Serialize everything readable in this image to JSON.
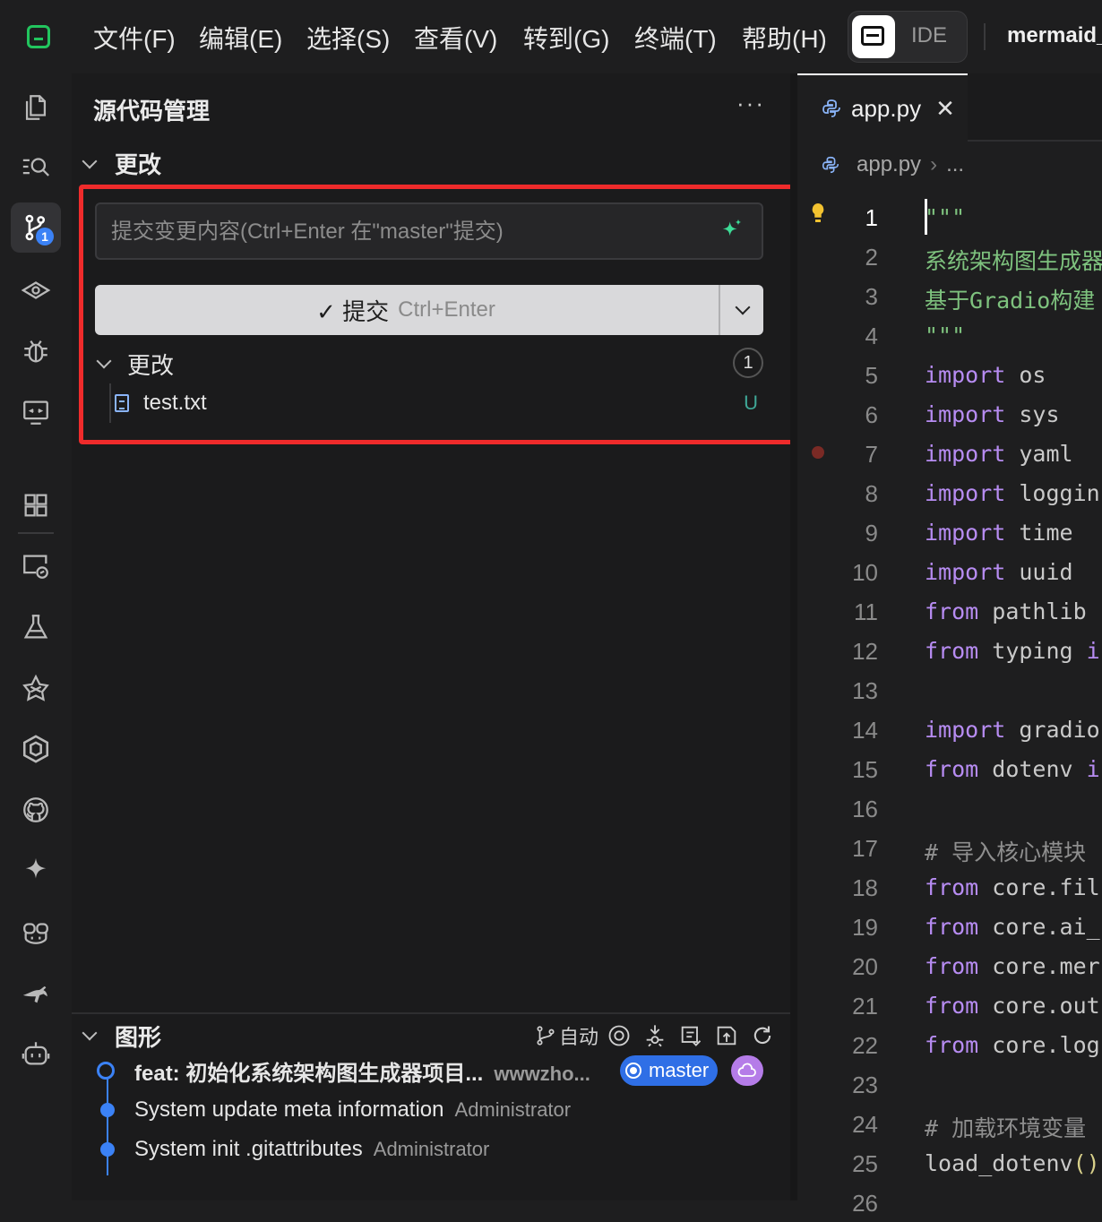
{
  "menu": {
    "items": [
      "文件(F)",
      "编辑(E)",
      "选择(S)",
      "查看(V)",
      "转到(G)",
      "终端(T)",
      "帮助(H)"
    ],
    "mode_label": "IDE",
    "project": "mermaid_"
  },
  "activity": {
    "scm_badge": "1",
    "icons": [
      "explorer-icon",
      "search-icon",
      "source-control-icon",
      "watch-icon",
      "debug-icon",
      "remote-display-icon",
      "extensions-icon",
      "remote-explorer-icon",
      "testing-icon",
      "deploy-icon",
      "hexagon-icon",
      "github-icon",
      "ai-sparkle-icon",
      "copilot-icon",
      "kangaroo-icon",
      "robot-icon"
    ]
  },
  "scm": {
    "title": "源代码管理",
    "more": "···",
    "section_label": "更改",
    "commit_placeholder": "提交变更内容(Ctrl+Enter 在\"master\"提交)",
    "commit_label": "✓ 提交",
    "commit_shortcut": "Ctrl+Enter",
    "changes_label": "更改",
    "changes_count": "1",
    "files": [
      {
        "name": "test.txt",
        "status": "U"
      }
    ]
  },
  "graph": {
    "title": "图形",
    "auto_label": "自动",
    "commits": [
      {
        "message": "feat: 初始化系统架构图生成器项目...",
        "author": "wwwzho...",
        "branch": "master"
      },
      {
        "message": "System update meta information",
        "author": "Administrator"
      },
      {
        "message": "System init .gitattributes",
        "author": "Administrator"
      }
    ]
  },
  "editor": {
    "tab_name": "app.py",
    "tab_close": "✕",
    "breadcrumb_file": "app.py",
    "breadcrumb_rest": "...",
    "lines": [
      {
        "n": "1",
        "segs": [
          [
            "str",
            "\"\"\""
          ]
        ]
      },
      {
        "n": "2",
        "segs": [
          [
            "str",
            "系统架构图生成器"
          ]
        ]
      },
      {
        "n": "3",
        "segs": [
          [
            "str",
            "基于Gradio构建"
          ]
        ]
      },
      {
        "n": "4",
        "segs": [
          [
            "str",
            "\"\"\""
          ]
        ]
      },
      {
        "n": "5",
        "segs": [
          [
            "kw",
            "import"
          ],
          [
            "id",
            " os"
          ]
        ]
      },
      {
        "n": "6",
        "segs": [
          [
            "kw",
            "import"
          ],
          [
            "id",
            " sys"
          ]
        ]
      },
      {
        "n": "7",
        "segs": [
          [
            "kw",
            "import"
          ],
          [
            "id",
            " yaml"
          ]
        ]
      },
      {
        "n": "8",
        "segs": [
          [
            "kw",
            "import"
          ],
          [
            "id",
            " loggin"
          ]
        ]
      },
      {
        "n": "9",
        "segs": [
          [
            "kw",
            "import"
          ],
          [
            "id",
            " time"
          ]
        ]
      },
      {
        "n": "10",
        "segs": [
          [
            "kw",
            "import"
          ],
          [
            "id",
            " uuid"
          ]
        ]
      },
      {
        "n": "11",
        "segs": [
          [
            "kw",
            "from"
          ],
          [
            "id",
            " pathlib"
          ]
        ]
      },
      {
        "n": "12",
        "segs": [
          [
            "kw",
            "from"
          ],
          [
            "id",
            " typing "
          ],
          [
            "kw",
            "i"
          ]
        ]
      },
      {
        "n": "13",
        "segs": []
      },
      {
        "n": "14",
        "segs": [
          [
            "kw",
            "import"
          ],
          [
            "id",
            " gradio"
          ]
        ]
      },
      {
        "n": "15",
        "segs": [
          [
            "kw",
            "from"
          ],
          [
            "id",
            " dotenv "
          ],
          [
            "kw",
            "i"
          ]
        ]
      },
      {
        "n": "16",
        "segs": []
      },
      {
        "n": "17",
        "segs": [
          [
            "cmt",
            "# 导入核心模块"
          ]
        ]
      },
      {
        "n": "18",
        "segs": [
          [
            "kw",
            "from"
          ],
          [
            "id",
            " core.fil"
          ]
        ]
      },
      {
        "n": "19",
        "segs": [
          [
            "kw",
            "from"
          ],
          [
            "id",
            " core.ai_"
          ]
        ]
      },
      {
        "n": "20",
        "segs": [
          [
            "kw",
            "from"
          ],
          [
            "id",
            " core.mer"
          ]
        ]
      },
      {
        "n": "21",
        "segs": [
          [
            "kw",
            "from"
          ],
          [
            "id",
            " core.out"
          ]
        ]
      },
      {
        "n": "22",
        "segs": [
          [
            "kw",
            "from"
          ],
          [
            "id",
            " core.log"
          ]
        ]
      },
      {
        "n": "23",
        "segs": []
      },
      {
        "n": "24",
        "segs": [
          [
            "cmt",
            "# 加载环境变量"
          ]
        ]
      },
      {
        "n": "25",
        "segs": [
          [
            "id",
            "load_dotenv"
          ],
          [
            "fn",
            "()"
          ]
        ]
      },
      {
        "n": "26",
        "segs": []
      }
    ]
  },
  "colors": {
    "accent": "#3b82f6",
    "highlight_border": "#ef2b2b",
    "untracked": "#3fa796",
    "keyword": "#b78cf2",
    "string": "#7ec27e"
  }
}
